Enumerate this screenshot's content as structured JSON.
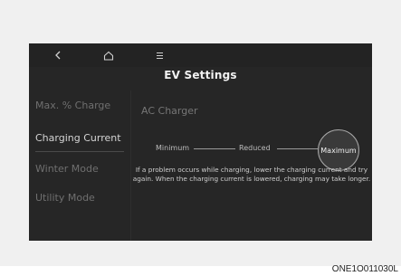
{
  "header": {
    "title": "EV Settings",
    "icons": [
      "back-icon",
      "home-icon",
      "menu-icon"
    ]
  },
  "sidebar": {
    "items": [
      {
        "label": "Max. % Charge",
        "active": false
      },
      {
        "label": "Charging Current",
        "active": true
      },
      {
        "label": "Winter Mode",
        "active": false
      },
      {
        "label": "Utility Mode",
        "active": false
      }
    ]
  },
  "main": {
    "section_title": "AC Charger",
    "levels": [
      "Minimum",
      "Reduced",
      "Maximum"
    ],
    "selected_level": "Maximum",
    "notice": "If a problem occurs while charging, lower the charging current and try again. When the charging current is lowered, charging may take longer."
  },
  "caption": "ONE1O011030L",
  "colors": {
    "screen_bg": "#262626",
    "text_active": "#d4d4d4",
    "text_inactive": "#6f6f6f"
  }
}
